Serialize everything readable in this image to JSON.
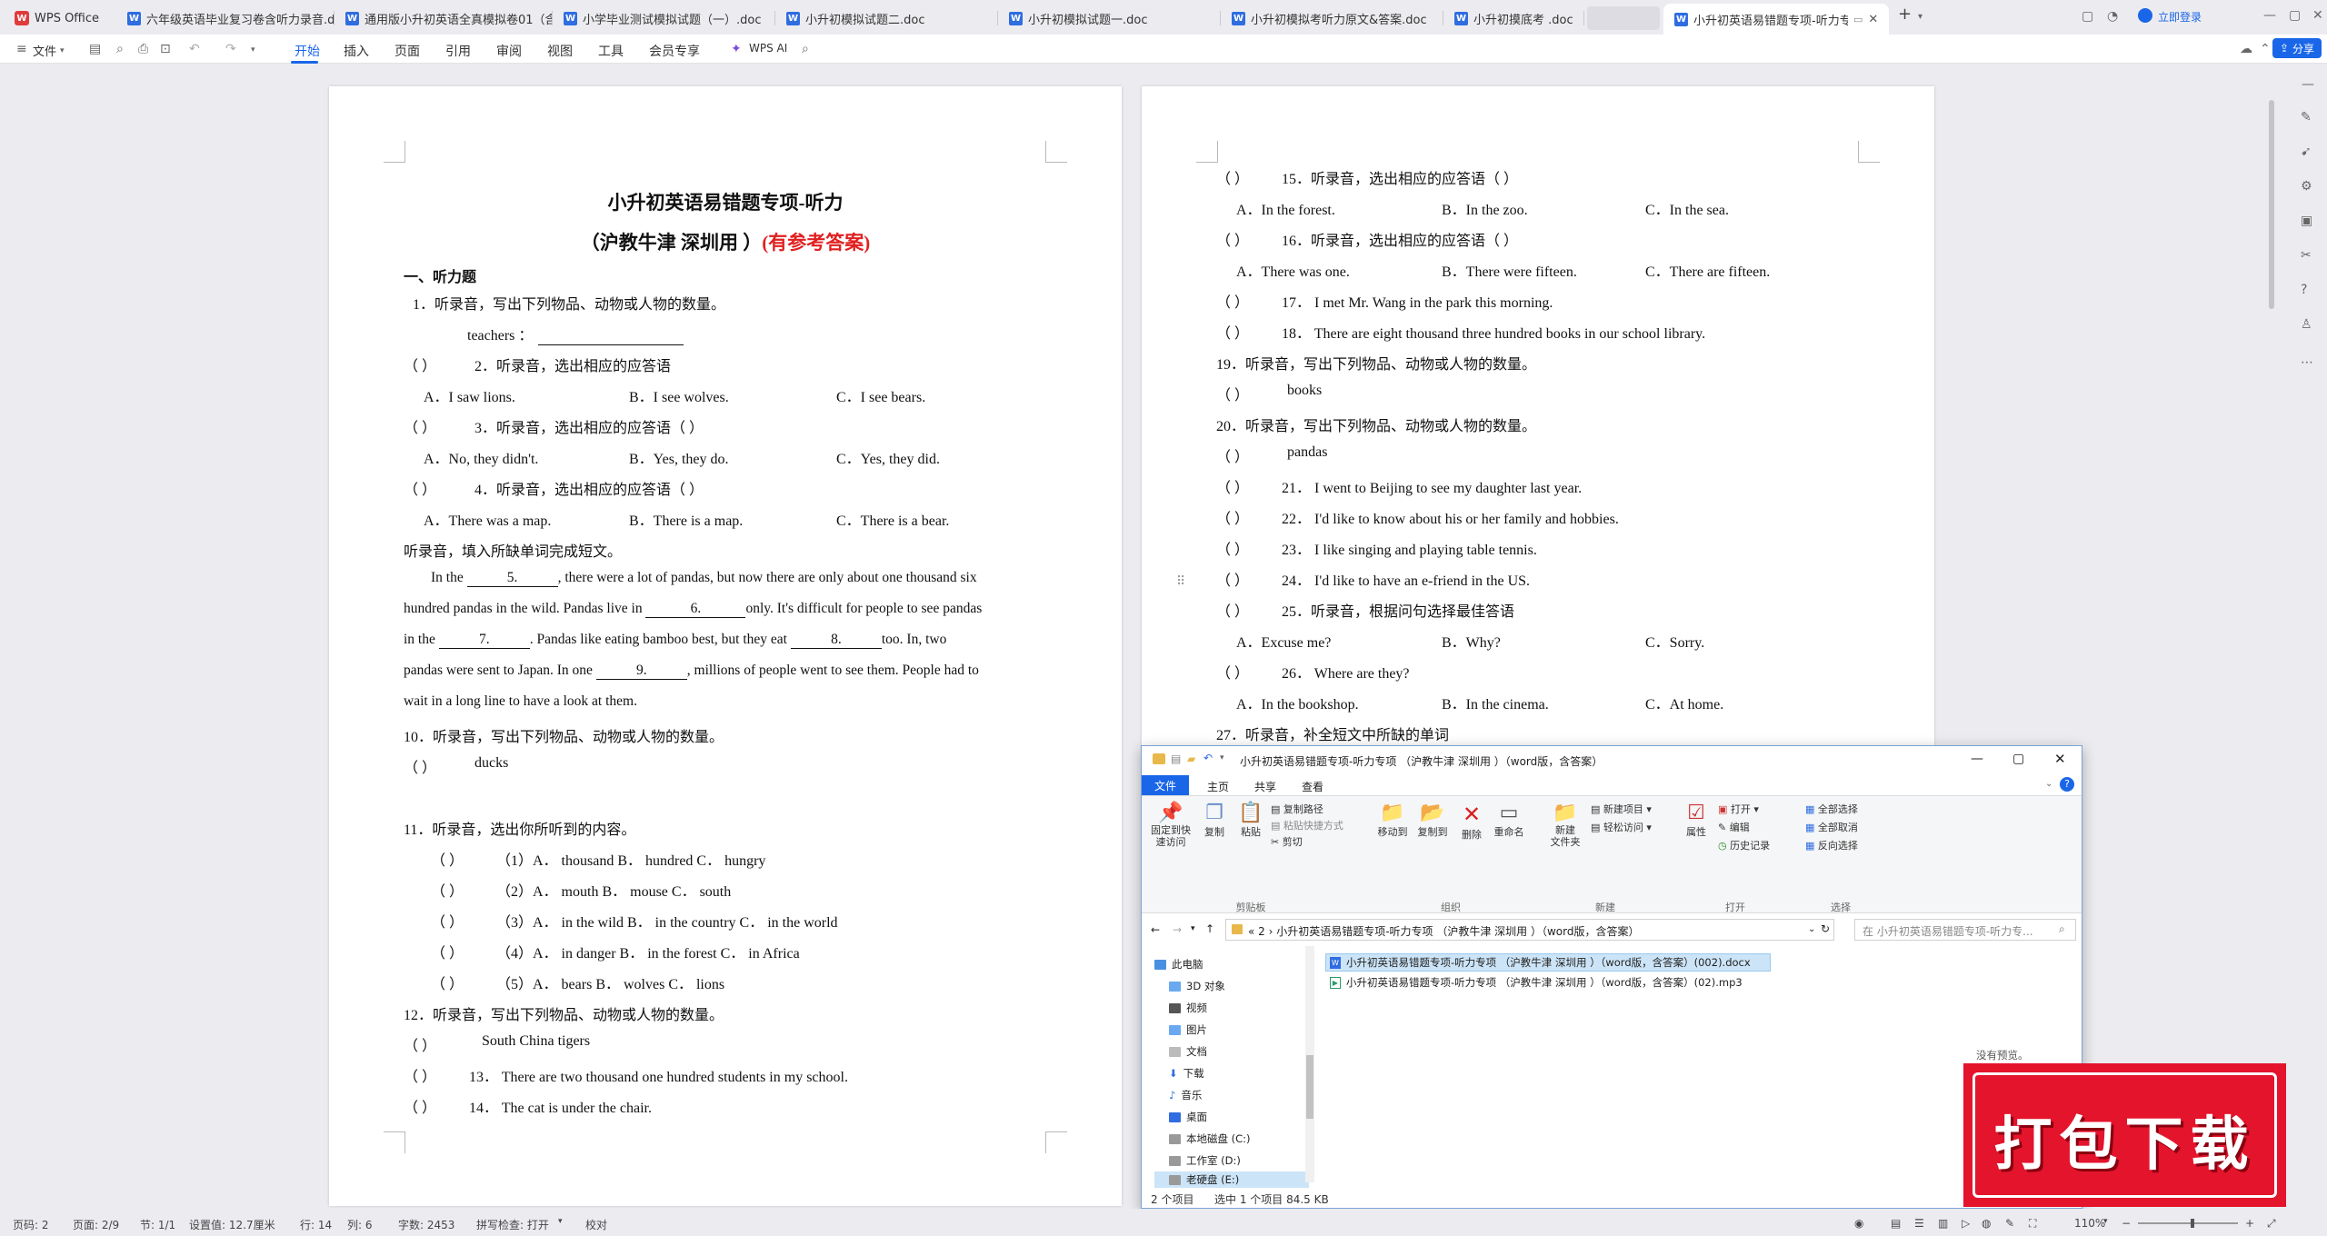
{
  "tabs": {
    "home": "WPS Office",
    "items": [
      {
        "label": "六年级英语毕业复习卷含听力录音.doc"
      },
      {
        "label": "通用版小升初英语全真模拟卷01（含"
      },
      {
        "label": "小学毕业测试模拟试题（一）.doc"
      },
      {
        "label": "小升初模拟试题二.doc"
      },
      {
        "label": "小升初模拟试题一.doc"
      },
      {
        "label": "小升初模拟考听力原文&答案.doc"
      },
      {
        "label": "小升初摸底考 .doc"
      },
      {
        "label": "小升初英语易错题专项-听力专"
      }
    ],
    "login": "立即登录"
  },
  "toolbar": {
    "file": "文件",
    "menus": [
      "开始",
      "插入",
      "页面",
      "引用",
      "审阅",
      "视图",
      "工具",
      "会员专享"
    ],
    "wps_ai": "WPS AI",
    "share": "分享"
  },
  "doc_left": {
    "title": "小升初英语易错题专项-听力",
    "subtitle_a": "（沪教牛津  深圳用  ）",
    "subtitle_b": "(有参考答案)",
    "section": "一、听力题",
    "lines": {
      "q1": "1．听录音，写出下列物品、动物或人物的数量。",
      "q1_item": "teachers  ：",
      "q2": "2．听录音，选出相应的应答语",
      "q2_a": "A．I saw lions.",
      "q2_b": "B．I see wolves.",
      "q2_c": "C．I see bears.",
      "q3": "3．听录音，选出相应的应答语（      ）",
      "q3_a": "A．No, they didn't.",
      "q3_b": "B．Yes, they do.",
      "q3_c": "C．Yes, they did.",
      "q4": "4．听录音，选出相应的应答语（      ）",
      "q4_a": "A．There was a map.",
      "q4_b": "B．There is a map.",
      "q4_c": "C．There is a bear.",
      "cloze_intro": "听录音，填入所缺单词完成短文。",
      "p1a": "In the",
      "b5": "5.",
      "p1b": ", there were a lot of pandas, but now there are only about one thousand six",
      "p2a": "hundred pandas in the wild. Pandas live in",
      "b6": "6.",
      "p2b": "only. It's difficult for people to see pandas",
      "p3a": "in the",
      "b7": "7.",
      "p3b": ". Pandas like eating bamboo best, but they eat",
      "b8": "8.",
      "p3c": "too. In, two",
      "p4a": "pandas were sent to Japan. In one",
      "b9": "9.",
      "p4b": ", millions of people went to see them. People had to",
      "p5": "wait in a long line to have a look at them.",
      "q10": "10．听录音，写出下列物品、动物或人物的数量。",
      "q10_item": "ducks",
      "q11": "11．听录音，选出你所听到的内容。",
      "q11_1": "（1）A． thousand  B． hundred  C． hungry",
      "q11_2": "（2）A．  mouth      B．  mouse    C．  south",
      "q11_3": "（3）A．  in the wild      B．  in the country      C．  in the world",
      "q11_4": "（4）A．  in danger  B．  in the forest   C．  in Africa",
      "q11_5": "（5）A．  bears B．  wolves   C．  lions",
      "q12": "12．听录音，写出下列物品、动物或人物的数量。",
      "q12_item": "South China tigers",
      "q13": "13．  There are two thousand one hundred students in my school.",
      "q14": "14．  The cat is under the chair."
    }
  },
  "doc_right": {
    "lines": {
      "q15": "15．听录音，选出相应的应答语（      ）",
      "q15_a": "A．In the forest.",
      "q15_b": "B．In the zoo.",
      "q15_c": "C．In the sea.",
      "q16": "16．听录音，选出相应的应答语（      ）",
      "q16_a": "A．There was one.",
      "q16_b": "B．There were fifteen.",
      "q16_c": "C．There are fifteen.",
      "q17": "17．  I met Mr. Wang in the park this morning.",
      "q18": "18．  There are eight thousand three hundred books in our school library.",
      "q19": "19．听录音，写出下列物品、动物或人物的数量。",
      "q19_item": "books",
      "q20": "20．听录音，写出下列物品、动物或人物的数量。",
      "q20_item": "pandas",
      "q21": "21．  I went to Beijing to see my daughter last year.",
      "q22": "22．  I'd like to know about his or her family and hobbies.",
      "q23": "23．  I like singing and playing table tennis.",
      "q24": "24．  I'd like to have an e-friend in the US.",
      "q25": "25．听录音，根据问句选择最佳答语",
      "q25_a": "A．Excuse me?",
      "q25_b": "B．Why?",
      "q25_c": "C．Sorry.",
      "q26": "26．  Where are they?",
      "q26_a": "A．In the bookshop.",
      "q26_b": "B．In the cinema.",
      "q26_c": "C．At home.",
      "q27": "27．听录音，补全短文中所缺的单词"
    }
  },
  "paren": "（        ）",
  "explorer": {
    "title": "小升初英语易错题专项-听力专项 （沪教牛津 深圳用 ）（word版，含答案）",
    "tabs": [
      "文件",
      "主页",
      "共享",
      "查看"
    ],
    "ribbon": {
      "pin": "固定到快\n速访问",
      "copy": "复制",
      "paste": "粘贴",
      "copy_path": "复制路径",
      "paste_shortcut": "粘贴快捷方式",
      "cut": "剪切",
      "move_to": "移动到",
      "copy_to": "复制到",
      "delete": "删除",
      "rename": "重命名",
      "new_folder": "新建\n文件夹",
      "new_item": "新建项目",
      "easy_access": "轻松访问",
      "properties": "属性",
      "open": "打开",
      "edit": "编辑",
      "history": "历史记录",
      "select_all": "全部选择",
      "select_none": "全部取消",
      "invert": "反向选择",
      "groups": [
        "剪贴板",
        "组织",
        "新建",
        "打开",
        "选择"
      ]
    },
    "address": "«  2  ›  小升初英语易错题专项-听力专项 （沪教牛津 深圳用 ）（word版，含答案）",
    "search_placeholder": "在 小升初英语易错题专项-听力专...",
    "nav": [
      "此电脑",
      "3D 对象",
      "视频",
      "图片",
      "文档",
      "下载",
      "音乐",
      "桌面",
      "本地磁盘 (C:)",
      "工作室 (D:)",
      "老硬盘 (E:)"
    ],
    "files": [
      {
        "name": "小升初英语易错题专项-听力专项 （沪教牛津 深圳用 ）（word版，含答案）(002).docx"
      },
      {
        "name": "小升初英语易错题专项-听力专项 （沪教牛津 深圳用 ）（word版，含答案）(02).mp3"
      }
    ],
    "no_preview": "没有预览。",
    "status_count": "2 个项目",
    "status_selected": "选中 1 个项目  84.5 KB"
  },
  "statusbar": {
    "page_num": "页码: 2",
    "pages": "页面: 2/9",
    "section": "节: 1/1",
    "setting": "设置值: 12.7厘米",
    "row": "行: 14",
    "col": "列: 6",
    "words": "字数: 2453",
    "spell": "拼写检查: 打开",
    "proof": "校对",
    "zoom": "110%"
  },
  "promo": {
    "text": "打包下载"
  },
  "colors": {
    "accent": "#1a66e8",
    "answer_red": "#e02020",
    "promo_red": "#e3142c"
  }
}
